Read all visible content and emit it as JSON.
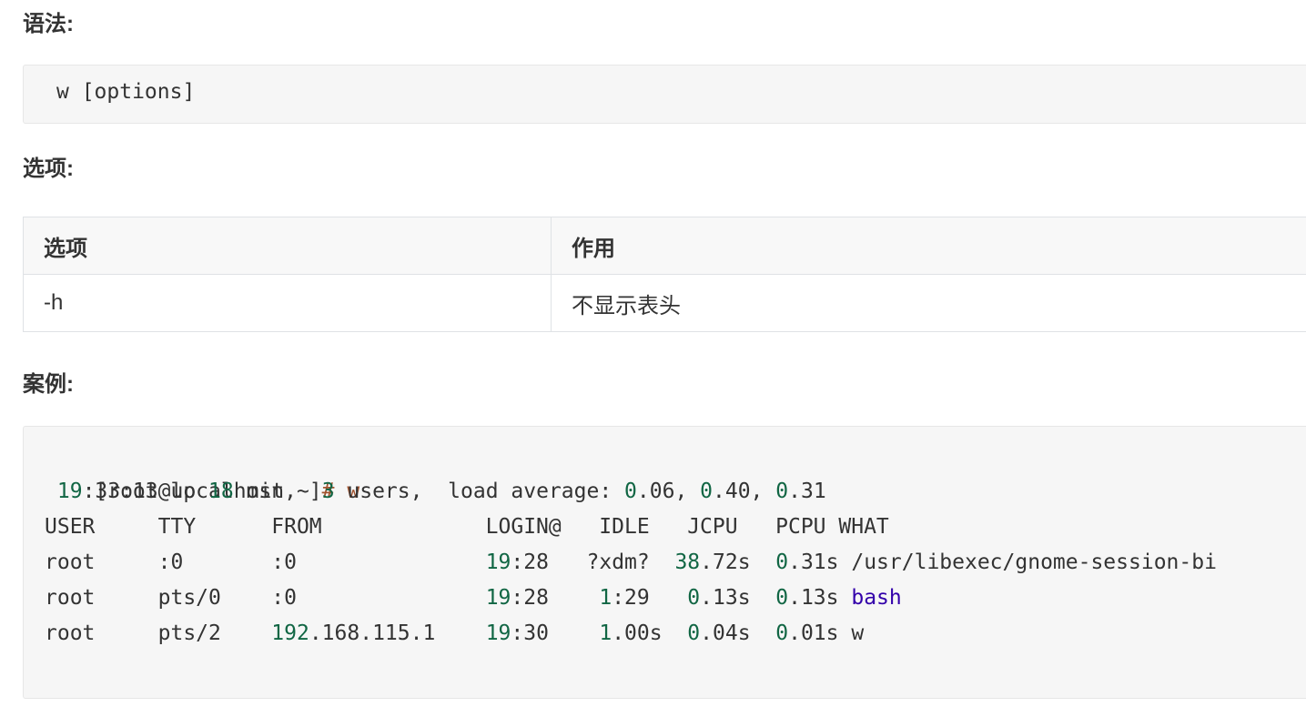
{
  "sections": {
    "syntax_title": "语法:",
    "options_title": "选项:",
    "example_title": "案例:"
  },
  "syntax": {
    "code": "w [options]"
  },
  "options_table": {
    "headers": [
      "选项",
      "作用"
    ],
    "rows": [
      [
        "-h",
        "不显示表头"
      ]
    ]
  },
  "example": {
    "prompt": "[root@localhost ~]",
    "prompt_hash": "#",
    "prompt_cmd": " w",
    "uptime": {
      "hour": "19",
      "rest_time": ":33:13 up ",
      "minutes": "18",
      "min_text": " min,  ",
      "users": "3",
      "users_text": " users,  load average: ",
      "load1_a": "0",
      "load1_b": ".06, ",
      "load2_a": "0",
      "load2_b": ".40, ",
      "load3_a": "0",
      "load3_b": ".31"
    },
    "header": "USER     TTY      FROM             LOGIN@   IDLE   JCPU   PCPU WHAT",
    "rows": [
      {
        "user": "root",
        "tty": ":0",
        "from_num": "",
        "from_rest": ":0",
        "login_h": "19",
        "login_m": ":28",
        "idle_num": "",
        "idle_rest": "?xdm?",
        "jcpu_num": "38",
        "jcpu_rest": ".72s",
        "pcpu_num": "0",
        "pcpu_rest": ".31s",
        "what": "/usr/libexec/gnome-session-bi"
      },
      {
        "user": "root",
        "tty": "pts/0",
        "from_num": "",
        "from_rest": ":0",
        "login_h": "19",
        "login_m": ":28",
        "idle_num": "1",
        "idle_rest": ":29",
        "jcpu_num": "0",
        "jcpu_rest": ".13s",
        "pcpu_num": "0",
        "pcpu_rest": ".13s",
        "what": "bash"
      },
      {
        "user": "root",
        "tty": "pts/2",
        "from_num": "192",
        "from_rest": ".168.115.1",
        "login_h": "19",
        "login_m": ":30",
        "idle_num": "1",
        "idle_rest": ".00s",
        "jcpu_num": "0",
        "jcpu_rest": ".04s",
        "pcpu_num": "0",
        "pcpu_rest": ".01s",
        "what": "w"
      }
    ]
  }
}
